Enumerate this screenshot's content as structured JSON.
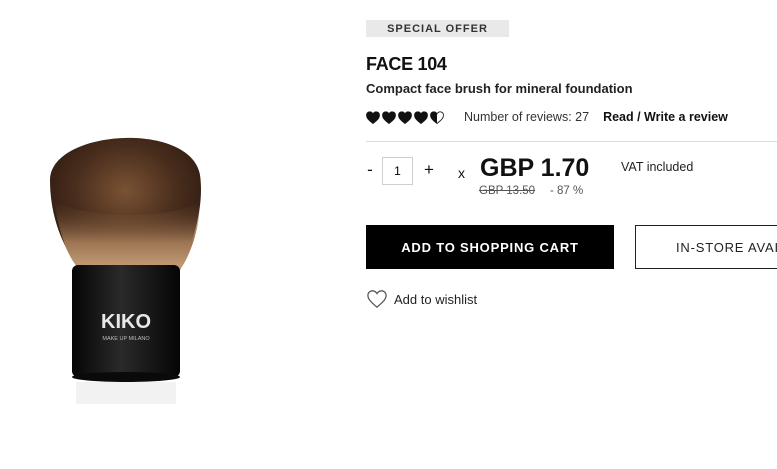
{
  "product": {
    "badge": "SPECIAL OFFER",
    "title": "FACE 104",
    "subtitle": "Compact face brush for mineral foundation",
    "image_icon": "kabuki-brush-image",
    "brand_logo": "KIKO",
    "brand_tagline": "MAKE UP MILANO"
  },
  "rating": {
    "value": 4.5,
    "max": 5,
    "reviews_text": "Number of reviews: 27",
    "reviews_link": "Read / Write a review"
  },
  "purchase": {
    "qty_minus": "-",
    "qty_value": "1",
    "qty_plus": "+",
    "times": "x",
    "price": "GBP 1.70",
    "old_price": "GBP 13.50",
    "discount": "- 87 %",
    "vat": "VAT included",
    "add_to_cart": "ADD TO SHOPPING CART",
    "in_store": "IN-STORE AVAILABILITY",
    "wishlist": "Add to wishlist"
  },
  "colors": {
    "primary_button": "#000000",
    "badge_bg": "#e9e9e9"
  }
}
